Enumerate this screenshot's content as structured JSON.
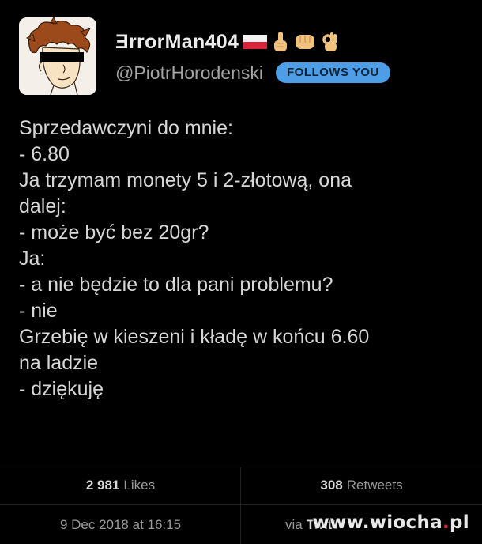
{
  "profile": {
    "display_name": "ƎrrorMan404",
    "handle": "@PiotrHorodenski",
    "badge": "FOLLOWS YOU",
    "name_emojis": [
      "flag-poland-icon",
      "pointing-up-hand-icon",
      "fist-icon",
      "ok-hand-icon"
    ]
  },
  "tweet": {
    "lines": [
      "Sprzedawczyni do mnie:",
      "- 6.80",
      "Ja trzymam monety 5 i 2-złotową, ona",
      "dalej:",
      "- może być bez 20gr?",
      "Ja:",
      "- a nie będzie to dla pani problemu?",
      "- nie",
      "Grzebię w kieszeni i kładę w końcu 6.60",
      "na ladzie",
      "- dziękuję"
    ]
  },
  "stats": {
    "likes_count": "2 981",
    "likes_label": "Likes",
    "retweets_count": "308",
    "retweets_label": "Retweets"
  },
  "meta": {
    "date": "9 Dec 2018 at 16:15",
    "via_label": "via",
    "app_name": "Twitt"
  },
  "watermark": {
    "text_left": "www.wiocha",
    "text_dot": ".",
    "text_right": "pl"
  },
  "colors": {
    "background": "#000000",
    "badge": "#4d9ee7",
    "text": "#d7d7d7",
    "muted": "#9a9a9a"
  }
}
